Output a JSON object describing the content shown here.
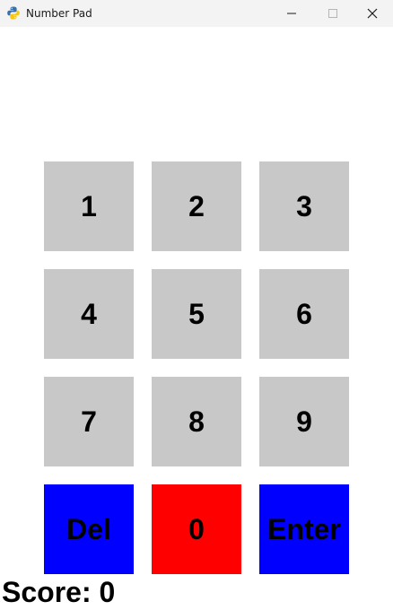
{
  "window": {
    "title": "Number Pad",
    "icon": "python-icon"
  },
  "keypad": {
    "digits": [
      {
        "label": "1",
        "color": "#c8c8c8"
      },
      {
        "label": "2",
        "color": "#c8c8c8"
      },
      {
        "label": "3",
        "color": "#c8c8c8"
      },
      {
        "label": "4",
        "color": "#c8c8c8"
      },
      {
        "label": "5",
        "color": "#c8c8c8"
      },
      {
        "label": "6",
        "color": "#c8c8c8"
      },
      {
        "label": "7",
        "color": "#c8c8c8"
      },
      {
        "label": "8",
        "color": "#c8c8c8"
      },
      {
        "label": "9",
        "color": "#c8c8c8"
      }
    ],
    "del": {
      "label": "Del",
      "color": "#0000ff"
    },
    "zero": {
      "label": "0",
      "color": "#ff0000"
    },
    "enter": {
      "label": "Enter",
      "color": "#0000ff"
    }
  },
  "score": {
    "label": "Score:",
    "value": "0"
  }
}
